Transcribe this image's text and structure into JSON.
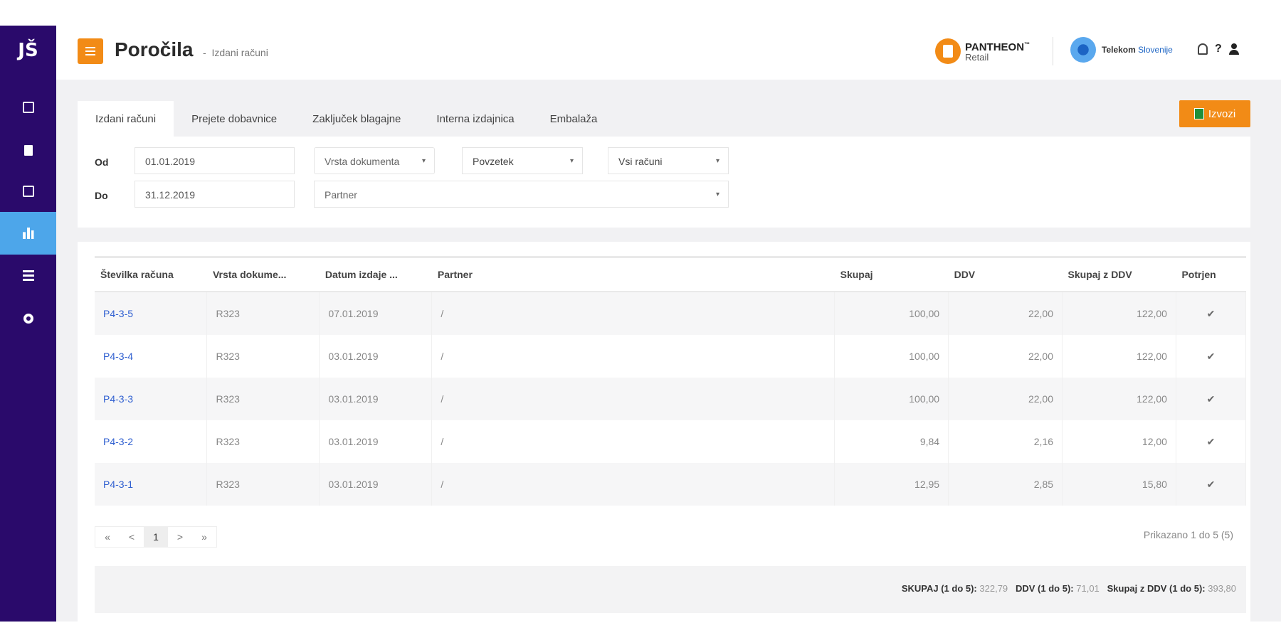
{
  "sidebar": {
    "logo": "JŠ",
    "items": [
      "orders-icon",
      "document-icon",
      "checklist-icon",
      "reports-icon",
      "list-icon",
      "settings-icon"
    ],
    "active_index": 3,
    "bg_color": "#2a0a6b",
    "active_color": "#4da6ea"
  },
  "header": {
    "title": "Poročila",
    "separator": "-",
    "subtitle": "Izdani računi",
    "pantheon_name": "PANTHEON",
    "pantheon_tm": "™",
    "pantheon_sub": "Retail",
    "telekom_bold": "Telekom",
    "telekom_rest": "Slovenije",
    "help": "?"
  },
  "tabs": [
    "Izdani računi",
    "Prejete dobavnice",
    "Zaključek blagajne",
    "Interna izdajnica",
    "Embalaža"
  ],
  "active_tab": 0,
  "export_label": "Izvozi",
  "filters": {
    "from_label": "Od",
    "from_value": "01.01.2019",
    "to_label": "Do",
    "to_value": "31.12.2019",
    "doc_type_placeholder": "Vrsta dokumenta",
    "summary_value": "Povzetek",
    "invoices_value": "Vsi računi",
    "partner_placeholder": "Partner"
  },
  "table": {
    "headers": [
      "Številka računa",
      "Vrsta dokume...",
      "Datum izdaje ...",
      "Partner",
      "Skupaj",
      "DDV",
      "Skupaj z DDV",
      "Potrjen"
    ],
    "rows": [
      {
        "number": "P4-3-5",
        "type": "R323",
        "date": "07.01.2019",
        "partner": "/",
        "total": "100,00",
        "vat": "22,00",
        "total_vat": "122,00",
        "confirmed": "✔"
      },
      {
        "number": "P4-3-4",
        "type": "R323",
        "date": "03.01.2019",
        "partner": "/",
        "total": "100,00",
        "vat": "22,00",
        "total_vat": "122,00",
        "confirmed": "✔"
      },
      {
        "number": "P4-3-3",
        "type": "R323",
        "date": "03.01.2019",
        "partner": "/",
        "total": "100,00",
        "vat": "22,00",
        "total_vat": "122,00",
        "confirmed": "✔"
      },
      {
        "number": "P4-3-2",
        "type": "R323",
        "date": "03.01.2019",
        "partner": "/",
        "total": "9,84",
        "vat": "2,16",
        "total_vat": "12,00",
        "confirmed": "✔"
      },
      {
        "number": "P4-3-1",
        "type": "R323",
        "date": "03.01.2019",
        "partner": "/",
        "total": "12,95",
        "vat": "2,85",
        "total_vat": "15,80",
        "confirmed": "✔"
      }
    ]
  },
  "pagination": {
    "first": "«",
    "prev": "<",
    "current": "1",
    "next": ">",
    "last": "»",
    "shown_text": "Prikazano 1 do 5 (5)"
  },
  "totals": {
    "sum_label": "SKUPAJ (1 do 5):",
    "sum_value": "322,79",
    "vat_label": "DDV (1 do 5):",
    "vat_value": "71,01",
    "sum_vat_label": "Skupaj z DDV (1 do 5):",
    "sum_vat_value": "393,80"
  },
  "colors": {
    "accent": "#f28b16",
    "link": "#2f5fd0"
  }
}
